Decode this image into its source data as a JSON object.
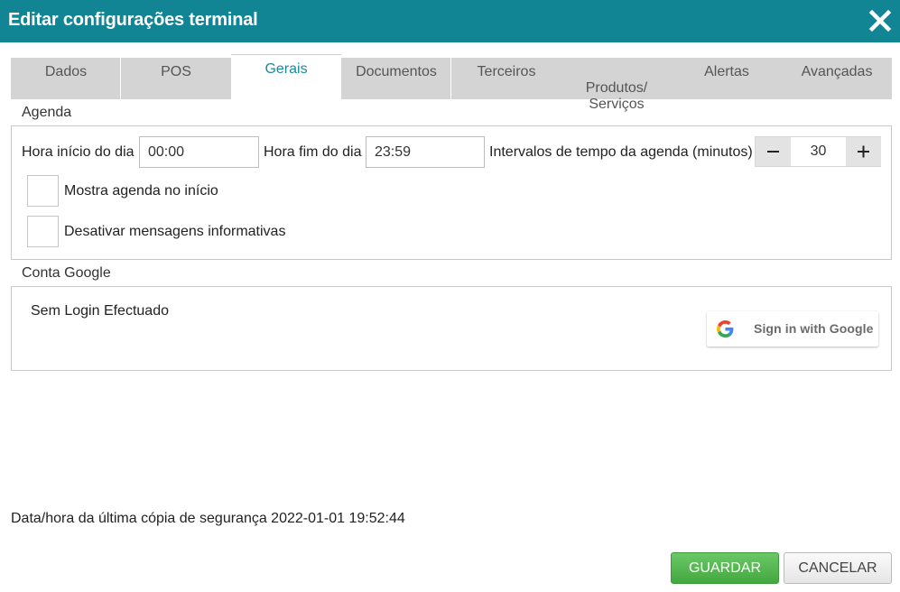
{
  "window": {
    "title": "Editar configurações terminal",
    "close_icon": "close-icon"
  },
  "tabs": [
    {
      "label": "Dados",
      "active": false
    },
    {
      "label": "POS",
      "active": false
    },
    {
      "label": "Gerais",
      "active": true
    },
    {
      "label": "Documentos",
      "active": false
    },
    {
      "label": "Terceiros",
      "active": false
    },
    {
      "label": "Produtos/\nServiços",
      "active": false
    },
    {
      "label": "Alertas",
      "active": false
    },
    {
      "label": "Avançadas",
      "active": false
    }
  ],
  "agenda": {
    "section_title": "Agenda",
    "start_label": "Hora início do dia",
    "start_value": "00:00",
    "end_label": "Hora fim do dia",
    "end_value": "23:59",
    "interval_label": "Intervalos de tempo da agenda (minutos)",
    "interval_value": "30",
    "show_on_start_label": "Mostra agenda no início",
    "disable_info_label": "Desativar mensagens informativas"
  },
  "google": {
    "section_title": "Conta Google",
    "status": "Sem Login Efectuado",
    "signin_label": "Sign in with Google",
    "icon": "google-g-icon"
  },
  "footer": {
    "backup_text": "Data/hora da última cópia de segurança 2022-01-01 19:52:44",
    "save_label": "GUARDAR",
    "cancel_label": "CANCELAR"
  },
  "colors": {
    "titlebar": "#128595",
    "active_tab_text": "#1a8a9a",
    "save_button": "#4caf50"
  }
}
